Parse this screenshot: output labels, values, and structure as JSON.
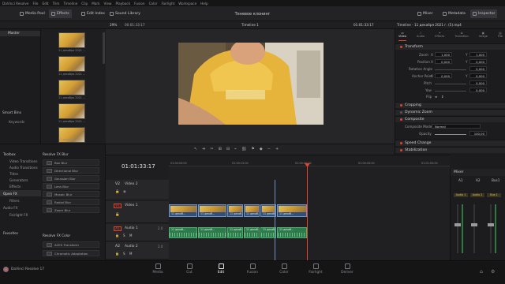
{
  "menu": [
    "DaVinci Resolve",
    "File",
    "Edit",
    "Trim",
    "Timeline",
    "Clip",
    "Mark",
    "View",
    "Playback",
    "Fusion",
    "Color",
    "Fairlight",
    "Workspace",
    "Help"
  ],
  "toolbar": {
    "media_pool": "Media Pool",
    "effects": "Effects",
    "edit_index": "Edit Index",
    "sound_library": "Sound Library",
    "project_title": "Теневое клонинг",
    "mixer": "Mixer",
    "metadata": "Metadata",
    "inspector": "Inspector"
  },
  "subbar": {
    "zoom": "29%",
    "timecode": "00:01:33:17",
    "timeline_name": "Timeline 1",
    "viewer_timecode": "01:01:33:17",
    "inspector_clip": "Timeline - 11 декабря 2021 г. (5).mp4"
  },
  "bins": {
    "master": "Master",
    "smart_bins": "Smart Bins",
    "keywords": "Keywords"
  },
  "clips": [
    "11 декабря 2021 ...",
    "11 декабря 2021 ...",
    "11 декабря 2021 ...",
    "11 декабря 2021 ...",
    "11 декабря 2021 ..."
  ],
  "inspector": {
    "tabs": [
      "Video",
      "Audio",
      "Effects",
      "Transition",
      "Image",
      "File"
    ],
    "transform": "Transform",
    "rows": [
      {
        "label": "Zoom",
        "x": "1,000",
        "y": "1,000"
      },
      {
        "label": "Position",
        "x": "0,000",
        "y": "0,000"
      },
      {
        "label": "Rotation Angle",
        "x": "0,000"
      },
      {
        "label": "Anchor Point",
        "x": "0,000",
        "y": "0,000"
      },
      {
        "label": "Pitch",
        "x": "0,000"
      },
      {
        "label": "Yaw",
        "x": "0,000"
      },
      {
        "label": "Flip",
        "x": ""
      }
    ],
    "cropping": "Cropping",
    "dynamic_zoom": "Dynamic Zoom",
    "composite": "Composite",
    "composite_mode_label": "Composite Mode",
    "composite_mode": "Normal",
    "opacity_label": "Opacity",
    "opacity": "100,00",
    "speed_change": "Speed Change",
    "stabilization": "Stabilization"
  },
  "toolbox": {
    "items": [
      "Toolbox",
      "Video Transitions",
      "Audio Transitions",
      "Titles",
      "Generators",
      "Effects",
      "Open FX",
      "Filters",
      "Audio FX",
      "Fairlight FX"
    ],
    "favorites": "Favorites",
    "resolve_blur_title": "Resolve FX Blur",
    "blur_items": [
      "Box Blur",
      "Directional Blur",
      "Gaussian Blur",
      "Lens Blur",
      "Mosaic Blur",
      "Radial Blur",
      "Zoom Blur"
    ],
    "resolve_color_title": "Resolve FX Color",
    "color_items": [
      "ACES Transform",
      "Chromatic Adaptation"
    ]
  },
  "timeline": {
    "timecode": "01:01:33:17",
    "tracks": [
      {
        "id": "V2",
        "name": "Video 2"
      },
      {
        "id": "V1",
        "name": "Video 1"
      },
      {
        "id": "A1",
        "name": "Audio 1",
        "level": "2.0"
      },
      {
        "id": "A2",
        "name": "Audio 2",
        "level": "2.0"
      }
    ],
    "ruler": [
      "01:00:00:00",
      "01:00:15:00",
      "01:00:30:00",
      "01:00:45:00",
      "01:01:00:00"
    ],
    "clip_label": "11 декаб..."
  },
  "mixer": {
    "title": "Mixer",
    "channels": [
      "A1",
      "A2",
      "Bus1"
    ],
    "audio_labels": [
      "Audio 1",
      "Audio 2",
      "Bus 1"
    ]
  },
  "status": {
    "app": "DaVinci Resolve 17"
  },
  "pages": [
    "Media",
    "Cut",
    "Edit",
    "Fusion",
    "Color",
    "Fairlight",
    "Deliver"
  ],
  "active_page": "Edit",
  "colors": {
    "accent": "#e2432f",
    "audio_clip": "#2f7a4c",
    "video_clip": "#3b5f8f",
    "playhead": "#e2432f"
  }
}
